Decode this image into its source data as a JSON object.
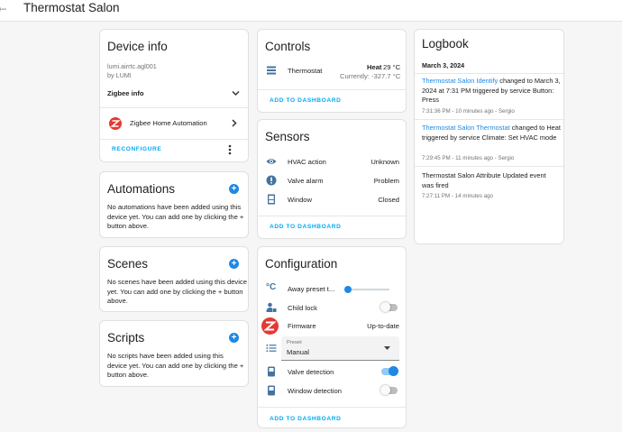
{
  "page": {
    "title": "Thermostat Salon",
    "back_glyph": "⇠"
  },
  "device_info": {
    "title": "Device info",
    "model": "lumi.airrtc.agl001",
    "by": "by LUMI",
    "zigbee_info": "Zigbee info",
    "integration": "Zigbee Home Automation",
    "reconfigure": "RECONFIGURE"
  },
  "automations": {
    "title": "Automations",
    "text": "No automations have been added using this device yet. You can add one by clicking the + button above."
  },
  "scenes": {
    "title": "Scenes",
    "text": "No scenes have been added using this device yet. You can add one by clicking the + button above."
  },
  "scripts": {
    "title": "Scripts",
    "text": "No scripts have been added using this device yet. You can add one by clicking the + button above."
  },
  "controls": {
    "title": "Controls",
    "entity": "Thermostat",
    "mode": "Heat",
    "target": "29 °C",
    "current": "Currently: -327.7 °C",
    "add": "ADD TO DASHBOARD"
  },
  "sensors": {
    "title": "Sensors",
    "rows": [
      {
        "name": "HVAC action",
        "value": "Unknown",
        "icon": "eye-icon"
      },
      {
        "name": "Valve alarm",
        "value": "Problem",
        "icon": "alert-icon"
      },
      {
        "name": "Window",
        "value": "Closed",
        "icon": "window-icon"
      }
    ],
    "add": "ADD TO DASHBOARD"
  },
  "configuration": {
    "title": "Configuration",
    "away": "Away preset t...",
    "away_level": 0,
    "child_lock": "Child lock",
    "child_lock_on": false,
    "firmware": "Firmware",
    "firmware_value": "Up-to-date",
    "preset_label": "Preset",
    "preset_value": "Manual",
    "valve": "Valve detection",
    "valve_on": true,
    "window": "Window detection",
    "window_on": false,
    "add": "ADD TO DASHBOARD"
  },
  "logbook": {
    "title": "Logbook",
    "date": "March 3, 2024",
    "entries": [
      {
        "entity": "Thermostat Salon Identify",
        "text": " changed to March 3, 2024 at 7:31 PM triggered by service Button: Press",
        "meta": "7:31:36 PM - 10 minutes ago - Sergio"
      },
      {
        "entity": "Thermostat Salon Thermostat",
        "text": " changed to Heat triggered by service Climate: Set HVAC mode",
        "meta": "7:29:45 PM - 11 minutes ago - Sergio"
      },
      {
        "entity": "",
        "text": "Thermostat Salon Attribute Updated event was fired",
        "meta": "7:27:11 PM - 14 minutes ago"
      }
    ]
  },
  "colors": {
    "accent": "#1e88e5",
    "link": "#03a9f4",
    "zigbee": "#e53935"
  }
}
